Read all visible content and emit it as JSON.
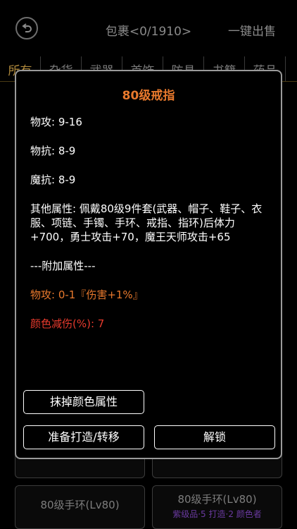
{
  "header": {
    "title": "包裹<0/1910>",
    "sell_all": "一键出售"
  },
  "tabs": [
    "所有",
    "杂货",
    "武器",
    "首饰",
    "防具",
    "书籍",
    "药品"
  ],
  "active_tab": 0,
  "background_items": [
    {
      "name": "80级手环(Lv80)",
      "sub": ""
    },
    {
      "name": "80级手环(Lv80)",
      "sub": "紫级品·5 打造·2 颜色者"
    }
  ],
  "dialog": {
    "title": "80级戒指",
    "physical_attack": "物攻: 9-16",
    "physical_resist": "物抗: 8-9",
    "magic_resist": "魔抗: 8-9",
    "other_attributes": "其他属性: 佩戴80级9件套(武器、帽子、鞋子、衣服、项链、手镯、手环、戒指、指环)后体力+700，勇士攻击+70，魔王天师攻击+65",
    "extra_header": "---附加属性---",
    "extra_attack": "物攻: 0-1『伤害+1%』",
    "color_reduction": "颜色减伤(%): 7",
    "erase_color_button": "抹掉颜色属性",
    "forge_button": "准备打造/转移",
    "unlock_button": "解锁"
  },
  "colors": {
    "accent_orange": "#e8792d",
    "accent_red": "#e83a2d",
    "tab_active": "#b08a3c"
  }
}
